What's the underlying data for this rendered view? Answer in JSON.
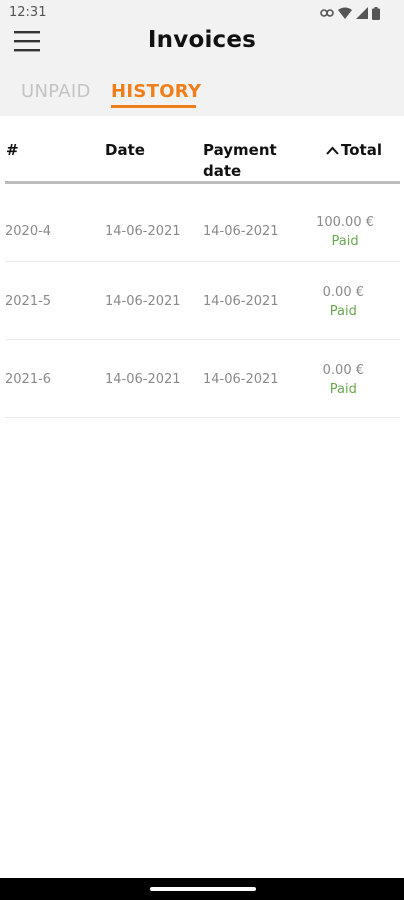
{
  "status_bar": {
    "time": "12:31"
  },
  "header": {
    "title": "Invoices",
    "tabs": [
      {
        "label": "UNPAID",
        "active": false
      },
      {
        "label": "HISTORY",
        "active": true
      }
    ]
  },
  "table": {
    "columns": {
      "number": "#",
      "date": "Date",
      "payment_date": "Payment date",
      "total": "Total"
    },
    "rows": [
      {
        "number": "2020-4",
        "date": "14-06-2021",
        "payment_date": "14-06-2021",
        "amount": "100.00 €",
        "status": "Paid"
      },
      {
        "number": "2021-5",
        "date": "14-06-2021",
        "payment_date": "14-06-2021",
        "amount": "0.00 €",
        "status": "Paid"
      },
      {
        "number": "2021-6",
        "date": "14-06-2021",
        "payment_date": "14-06-2021",
        "amount": "0.00 €",
        "status": "Paid"
      }
    ]
  },
  "colors": {
    "accent": "#ef7f1a",
    "paid": "#6aa84f",
    "inactive_tab": "#c4c4c4"
  },
  "icons": [
    "menu-icon",
    "sort-up-icon",
    "link-icon",
    "wifi-icon",
    "signal-icon",
    "battery-icon"
  ]
}
